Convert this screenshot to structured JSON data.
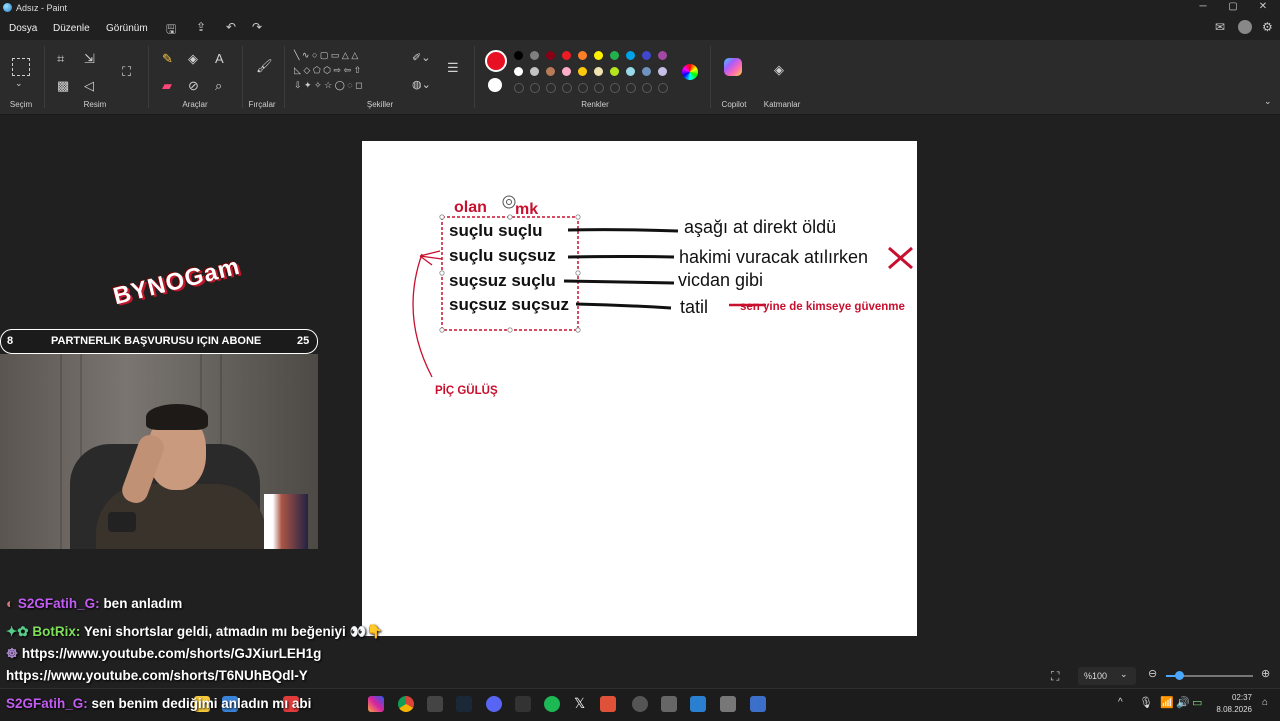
{
  "window": {
    "title": "Adsız - Paint",
    "minimize": "─",
    "maximize": "▢",
    "close": "✕"
  },
  "menu": {
    "items": [
      "Dosya",
      "Düzenle",
      "Görünüm"
    ]
  },
  "ribbon": {
    "groups": [
      "Seçim",
      "Resim",
      "Araçlar",
      "Fırçalar",
      "Şekiller",
      "Renkler",
      "Copilot",
      "Katmanlar"
    ]
  },
  "colors": {
    "primary": "#e81123",
    "secondary": "#ffffff",
    "row1": [
      "#000000",
      "#7f7f7f",
      "#880015",
      "#ed1c24",
      "#ff7f27",
      "#fff200",
      "#22b14c",
      "#00a2e8",
      "#3f48cc",
      "#a349a4"
    ],
    "row2": [
      "#ffffff",
      "#c3c3c3",
      "#b97a57",
      "#ffaec9",
      "#ffc90e",
      "#efe4b0",
      "#b5e61d",
      "#99d9ea",
      "#7092be",
      "#c8bfe7"
    ]
  },
  "canvas": {
    "top_labels": [
      "olan",
      "mk"
    ],
    "box_lines": [
      "suçlu suçlu",
      "suçlu suçsuz",
      "suçsuz suçlu",
      "suçsuz suçsuz"
    ],
    "results": [
      "aşağı at direkt öldü",
      "hakimi vuracak atılırken",
      "vicdan gibi",
      "tatil"
    ],
    "annotation_right": "sen yine de kimseye güvenme",
    "annotation_bottom": "PİÇ GÜLÜŞ"
  },
  "overlay": {
    "logo": "BYNOGam",
    "banner_left": "8",
    "banner_text": "PARTNERLIK BAŞVURUSU IÇIN ABONE",
    "banner_right": "25"
  },
  "chat": [
    {
      "user": "S2GFatih_G:",
      "text": "ben anladım"
    },
    {
      "user": "BotRix:",
      "text": "Yeni shortslar geldi, atmadın mı beğeniyi 👀👇"
    },
    {
      "user": "",
      "text": "https://www.youtube.com/shorts/GJXiurLEH1g"
    },
    {
      "user": "",
      "text": "https://www.youtube.com/shorts/T6NUhBQdl-Y"
    },
    {
      "user": "S2GFatih_G:",
      "text": "sen benim dediğimi anladın mı abi"
    }
  ],
  "status": {
    "zoom": "%100"
  },
  "taskbar": {
    "time": "02:37",
    "date": "8.08.2026"
  }
}
